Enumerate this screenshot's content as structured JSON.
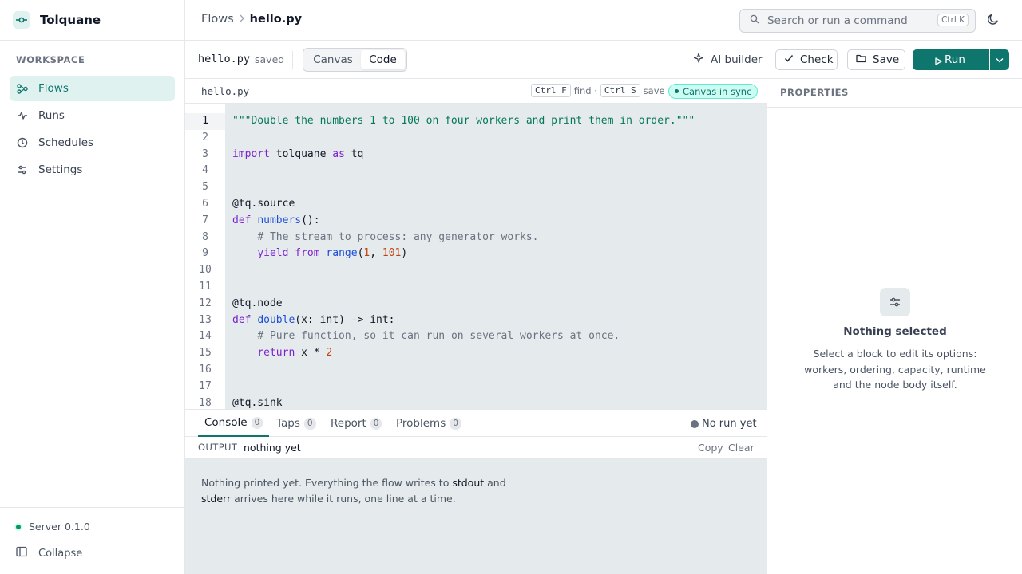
{
  "app": {
    "name": "Tolquane"
  },
  "sidebar": {
    "section_label": "WORKSPACE",
    "items": [
      {
        "label": "Flows",
        "icon": "flows-icon",
        "active": true
      },
      {
        "label": "Runs",
        "icon": "activity-icon"
      },
      {
        "label": "Schedules",
        "icon": "clock-icon"
      },
      {
        "label": "Settings",
        "icon": "sliders-icon"
      }
    ],
    "server_label": "Server 0.1.0",
    "collapse_label": "Collapse"
  },
  "header": {
    "breadcrumb": [
      "Flows",
      "hello.py"
    ],
    "search_placeholder": "Search or run a command",
    "search_shortcut": "Ctrl K"
  },
  "toolbar": {
    "file_name": "hello.py",
    "file_status": "saved",
    "views": [
      "Canvas",
      "Code"
    ],
    "active_view": "Code",
    "ai_builder_label": "AI builder",
    "check_label": "Check",
    "save_label": "Save",
    "run_label": "Run"
  },
  "editor": {
    "file_name": "hello.py",
    "hint_find_key": "Ctrl F",
    "hint_find": "find ·",
    "hint_save_key": "Ctrl S",
    "hint_save": "save",
    "sync_badge": "Canvas in sync",
    "current_line": 1,
    "lines": [
      "\"\"\"Double the numbers 1 to 100 on four workers and print them in order.\"\"\"",
      "",
      "import tolquane as tq",
      "",
      "",
      "@tq.source",
      "def numbers():",
      "    # The stream to process: any generator works.",
      "    yield from range(1, 101)",
      "",
      "",
      "@tq.node",
      "def double(x: int) -> int:",
      "    # Pure function, so it can run on several workers at once.",
      "    return x * 2",
      "",
      "",
      "@tq.sink"
    ]
  },
  "console": {
    "tabs": [
      {
        "label": "Console",
        "count": "0"
      },
      {
        "label": "Taps",
        "count": "0"
      },
      {
        "label": "Report",
        "count": "0"
      },
      {
        "label": "Problems",
        "count": "0"
      }
    ],
    "run_status": "No run yet",
    "output_label": "OUTPUT",
    "output_value": "nothing yet",
    "copy_label": "Copy",
    "clear_label": "Clear",
    "message_part1": "Nothing printed yet. Everything the flow writes to ",
    "message_stdout": "stdout",
    "message_and": " and ",
    "message_stderr": "stderr",
    "message_part2": " arrives here while it runs, one line at a time."
  },
  "properties": {
    "title": "PROPERTIES",
    "empty_title": "Nothing selected",
    "empty_description": "Select a block to edit its options: workers, ordering, capacity, runtime and the node body itself."
  },
  "colors": {
    "accent": "#0f766e",
    "accent_light": "#e0f2ef",
    "code_bg": "#e5eaed"
  }
}
